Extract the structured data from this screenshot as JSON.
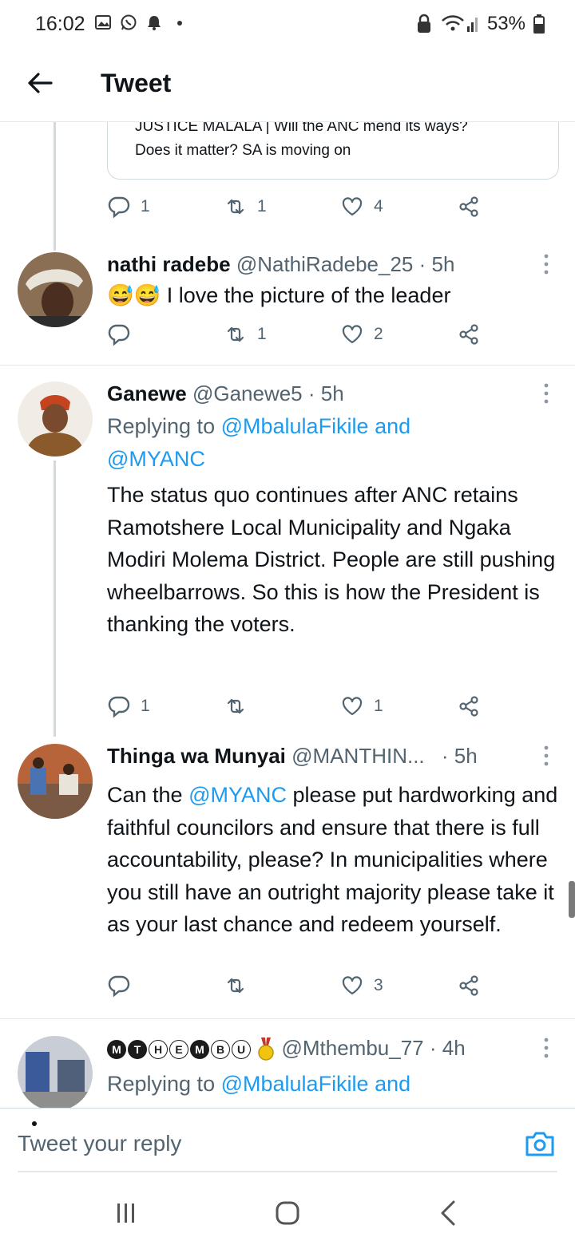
{
  "status_bar": {
    "time": "16:02",
    "battery": "53%"
  },
  "header": {
    "title": "Tweet"
  },
  "quoted_card": {
    "line1": "JUSTICE MALALA | Will the ANC mend its ways?",
    "line2": "Does it matter? SA is moving on"
  },
  "main_actions": {
    "replies": "1",
    "retweets": "1",
    "likes": "4"
  },
  "tweets": [
    {
      "name": "nathi radebe",
      "handle": "@NathiRadebe_25",
      "time": "· 5h",
      "text": "😅😅 I love the picture of the leader",
      "replies": "",
      "retweets": "1",
      "likes": "2"
    },
    {
      "name": "Ganewe",
      "handle": "@Ganewe5",
      "time": "· 5h",
      "replying_prefix": "Replying to",
      "replying_to": "@MbalulaFikile and @MYANC",
      "text": "The status quo continues after ANC retains Ramotshere Local Municipality and Ngaka Modiri Molema District. People are still pushing wheelbarrows. So this is how the President is thanking the voters.",
      "replies": "1",
      "retweets": "",
      "likes": "1"
    },
    {
      "name": "Thinga wa Munyai",
      "handle": "@MANTHIN...",
      "time": "· 5h",
      "text_before": "Can the",
      "mention": "@MYANC",
      "text_after": "please put hardworking and faithful councilors and ensure that there is full accountability, please? In municipalities where you still have an outright majority please take it as your last chance and redeem yourself.",
      "replies": "",
      "retweets": "",
      "likes": "3"
    },
    {
      "name_letters": [
        "M",
        "T",
        "H",
        "E",
        "M",
        "B",
        "U"
      ],
      "handle": "@Mthembu_77",
      "time": "· 4h",
      "replying_prefix": "Replying to",
      "replying_to": "@MbalulaFikile and @MYANC"
    }
  ],
  "reply_bar": {
    "placeholder": "Tweet your reply"
  },
  "icons": {
    "reply": "reply-icon",
    "retweet": "retweet-icon",
    "like": "heart-icon",
    "share": "share-icon"
  },
  "colors": {
    "link": "#1d9bf0",
    "muted": "#536471",
    "text": "#0f1419"
  }
}
